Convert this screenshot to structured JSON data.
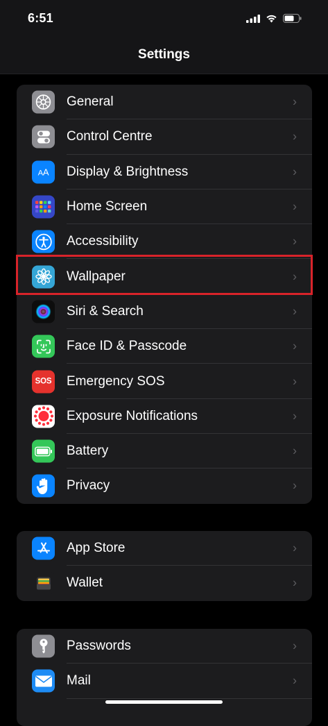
{
  "status_bar": {
    "time": "6:51"
  },
  "nav": {
    "title": "Settings"
  },
  "groups": [
    [
      {
        "label": "General",
        "icon": "gear-icon",
        "color": "#8e8e93"
      },
      {
        "label": "Control Centre",
        "icon": "toggles-icon",
        "color": "#8e8e93"
      },
      {
        "label": "Display & Brightness",
        "icon": "aa-text-icon",
        "color": "#0a84ff"
      },
      {
        "label": "Home Screen",
        "icon": "app-grid-icon",
        "color": "#3547c7"
      },
      {
        "label": "Accessibility",
        "icon": "accessibility-icon",
        "color": "#0a84ff"
      },
      {
        "label": "Wallpaper",
        "icon": "flower-icon",
        "color": "#35a6d6"
      },
      {
        "label": "Siri & Search",
        "icon": "siri-icon",
        "color": "#1a1a1a"
      },
      {
        "label": "Face ID & Passcode",
        "icon": "face-id-icon",
        "color": "#34c759"
      },
      {
        "label": "Emergency SOS",
        "icon": "sos-icon",
        "color": "#e5322d",
        "icon_text": "SOS"
      },
      {
        "label": "Exposure Notifications",
        "icon": "exposure-icon",
        "color": "#ffffff"
      },
      {
        "label": "Battery",
        "icon": "battery-icon",
        "color": "#34c759"
      },
      {
        "label": "Privacy",
        "icon": "hand-icon",
        "color": "#0a84ff"
      }
    ],
    [
      {
        "label": "App Store",
        "icon": "app-store-icon",
        "color": "#0a84ff"
      },
      {
        "label": "Wallet",
        "icon": "wallet-icon",
        "color": "#1c1c1e"
      }
    ],
    [
      {
        "label": "Passwords",
        "icon": "key-icon",
        "color": "#8e8e93"
      },
      {
        "label": "Mail",
        "icon": "envelope-icon",
        "color": "#1e8cf5"
      }
    ]
  ],
  "chevron": "›"
}
